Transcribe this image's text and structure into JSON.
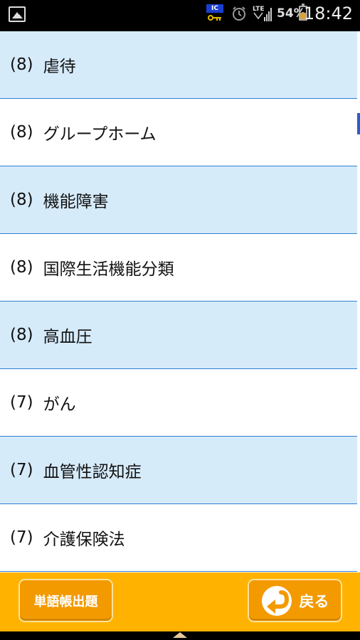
{
  "status_bar": {
    "ic_label": "IC",
    "network": "LTE",
    "battery_percent": "54%",
    "battery_level": 0.54,
    "time": "18:42",
    "icons": [
      "gallery-icon",
      "ic-key-icon",
      "alarm-icon",
      "lte-signal-icon",
      "battery-icon"
    ]
  },
  "list": {
    "items": [
      {
        "count": "(8)",
        "term": "虐待"
      },
      {
        "count": "(8)",
        "term": "グループホーム"
      },
      {
        "count": "(8)",
        "term": "機能障害"
      },
      {
        "count": "(8)",
        "term": "国際生活機能分類"
      },
      {
        "count": "(8)",
        "term": "高血圧"
      },
      {
        "count": "(7)",
        "term": "がん"
      },
      {
        "count": "(7)",
        "term": "血管性認知症"
      },
      {
        "count": "(7)",
        "term": "介護保険法"
      }
    ]
  },
  "toolbar": {
    "vocab_quiz_label": "単語帳出題",
    "back_label": "戻る"
  },
  "colors": {
    "row_shaded": "#d6ebfa",
    "row_divider": "#2f7fd6",
    "toolbar": "#ffb300",
    "button": "#f39a00"
  }
}
